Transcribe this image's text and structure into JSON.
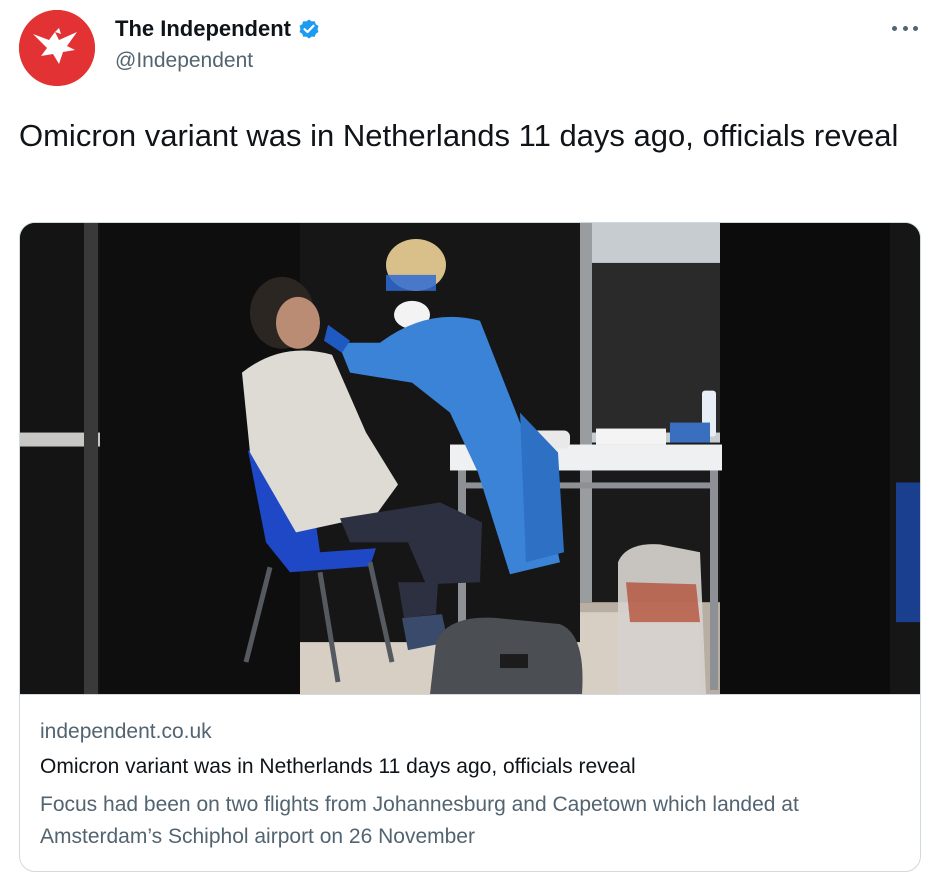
{
  "tweet": {
    "display_name": "The Independent",
    "handle": "@Independent",
    "verified": true,
    "text": "Omicron variant was in Netherlands 11 days ago, officials reveal",
    "more_icon": "more-horizontal-icon"
  },
  "card": {
    "domain": "independent.co.uk",
    "title": "Omicron variant was in Netherlands 11 days ago, officials reveal",
    "description": "Focus had been on two flights from Johannesburg and Capetown which landed at Amsterdam’s Schiphol airport on 26 November",
    "image_alt": "Health worker in blue protective gown and face shield swabbing a seated man at a testing booth"
  },
  "colors": {
    "brand_red": "#e23234",
    "verified_blue": "#1d9bf0",
    "text_primary": "#0f1419",
    "text_secondary": "#536471",
    "border": "#cfd9de"
  }
}
